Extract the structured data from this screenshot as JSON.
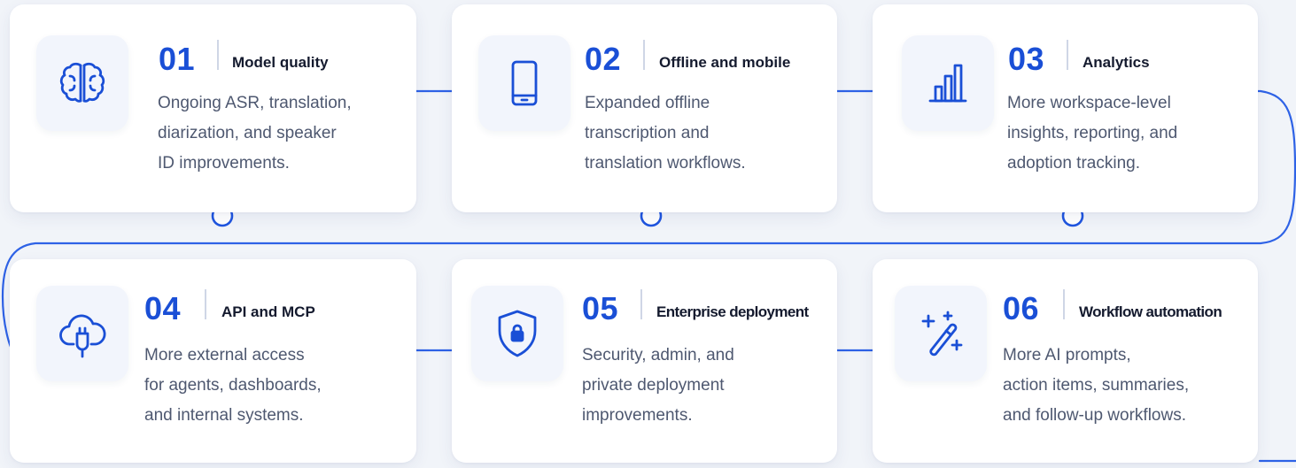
{
  "accent_color": "#1a4fd6",
  "items": [
    {
      "number": "01",
      "title": "Model quality",
      "icon": "brain-icon",
      "lines": [
        "Ongoing ASR, translation,",
        "diarization, and speaker",
        "ID improvements."
      ]
    },
    {
      "number": "02",
      "title": "Offline and mobile",
      "icon": "smartphone-icon",
      "lines": [
        "Expanded offline",
        "transcription and",
        "translation workflows."
      ]
    },
    {
      "number": "03",
      "title": "Analytics",
      "icon": "bar-chart-icon",
      "lines": [
        "More workspace-level",
        "insights, reporting, and",
        "adoption tracking."
      ]
    },
    {
      "number": "04",
      "title": "API and MCP",
      "icon": "cloud-plug-icon",
      "lines": [
        "More external access",
        "for agents, dashboards,",
        "and internal systems."
      ]
    },
    {
      "number": "05",
      "title": "Enterprise deployment",
      "icon": "shield-lock-icon",
      "lines": [
        "Security, admin, and",
        "private deployment",
        "improvements."
      ]
    },
    {
      "number": "06",
      "title": "Workflow automation",
      "icon": "magic-wand-icon",
      "lines": [
        "More AI prompts,",
        "action items, summaries,",
        "and follow-up workflows."
      ]
    }
  ]
}
